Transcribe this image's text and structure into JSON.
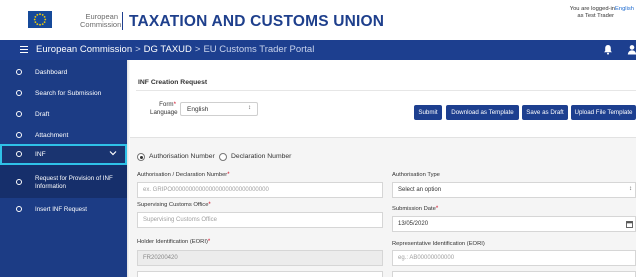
{
  "header": {
    "brand_line1": "European",
    "brand_line2": "Commission",
    "title": "TAXATION AND CUSTOMS UNION",
    "login_prefix": "You are logged-in",
    "login_lang": "English",
    "login_user": "as Test Trader"
  },
  "nav": {
    "crumbs": [
      "European Commission",
      "DG TAXUD",
      "EU Customs Trader Portal"
    ]
  },
  "sidebar": {
    "items": [
      {
        "label": "Dashboard"
      },
      {
        "label": "Search for Submission"
      },
      {
        "label": "Draft"
      },
      {
        "label": "Attachment"
      },
      {
        "label": "INF"
      }
    ],
    "sub_items": [
      {
        "label": "Request for Provision of INF Information"
      },
      {
        "label": "Insert INF Request"
      }
    ]
  },
  "form": {
    "title": "INF Creation Request",
    "language_label_line1": "Form",
    "language_label_line2": "Language",
    "language_value": "English",
    "buttons": {
      "submit": "Submit",
      "download_template": "Download as Template",
      "save_draft": "Save as Draft",
      "upload_template": "Upload File Template"
    },
    "radio": {
      "option1": "Authorisation Number",
      "option2": "Declaration Number",
      "selected": "Authorisation Number"
    },
    "fields": {
      "auth_decl_label": "Authorisation / Declaration Number",
      "auth_decl_placeholder": "ex. GRIPO00000000000000000000000000000",
      "auth_type_label": "Authorisation Type",
      "auth_type_value": "Select an option",
      "supervising_label": "Supervising Customs Office",
      "supervising_placeholder": "Supervising Customs Office",
      "submission_date_label": "Submission Date",
      "submission_date_value": "13/05/2020",
      "holder_label": "Holder Identification (EORI)",
      "holder_value": "FR20200420",
      "representative_label": "Representative Identification (EORI)",
      "representative_placeholder": "eg.: AB00000000000"
    }
  },
  "colors": {
    "brand_blue": "#1d3f8f",
    "sidebar_blue": "#1c3c85",
    "active_outline": "#2fc2e8",
    "required": "#d0021b"
  }
}
